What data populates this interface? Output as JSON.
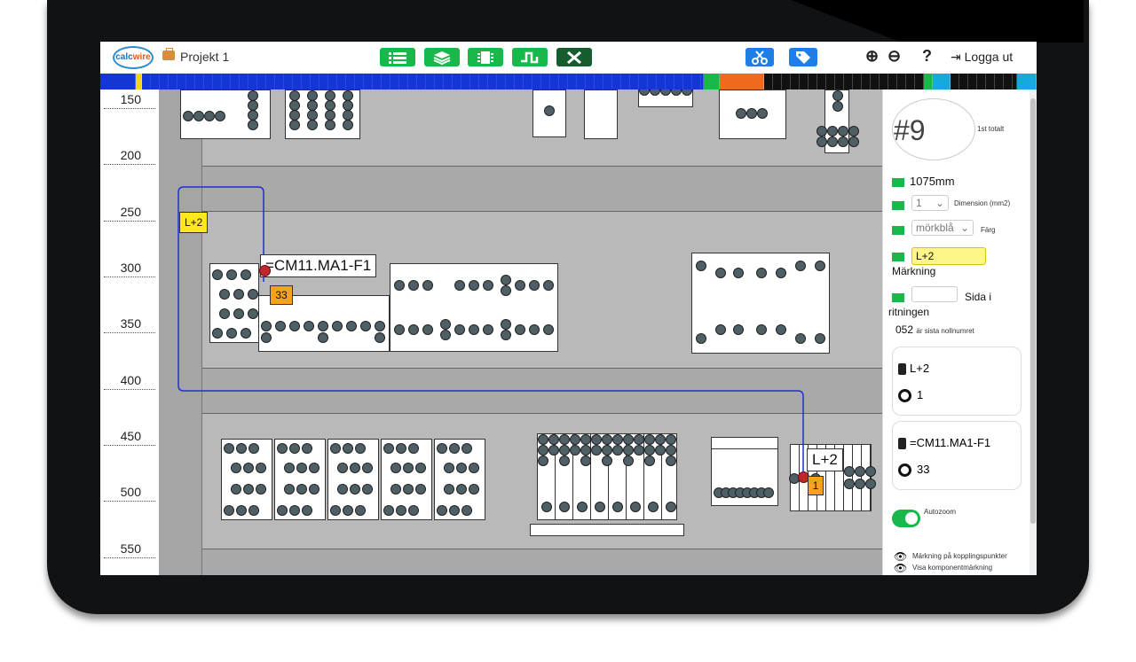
{
  "app": {
    "logo_calc": "calc",
    "logo_wire": "wire",
    "project": "Projekt 1",
    "logout": "Logga ut"
  },
  "toolbar": {
    "buttons": [
      "list-icon",
      "layers-icon",
      "component-icon",
      "signal-icon",
      "tools-icon"
    ],
    "right_buttons": [
      "cut-icon",
      "tag-icon"
    ],
    "zoom_in": "⊕",
    "zoom_out": "⊖",
    "help": "?"
  },
  "strip": {
    "marker_first": "1",
    "marker_selected": "L+2"
  },
  "ruler": {
    "ticks": [
      "150",
      "200",
      "250",
      "300",
      "350",
      "400",
      "450",
      "500",
      "550"
    ]
  },
  "canvas": {
    "start_label": "L+2",
    "start_component": "=CM11.MA1-F1",
    "start_point": "33",
    "end_label": "L+2",
    "end_point": "1"
  },
  "panel": {
    "wire_number": "#9",
    "wire_number_note": "1st totalt",
    "length": "1075mm",
    "dimension_value": "1",
    "dimension_label": "Dimension (mm2)",
    "color_value": "mörkblå",
    "color_label": "Färg",
    "marking_value": "L+2",
    "marking_label": "Märkning",
    "page_label": "Sida i ritningen",
    "last_number": "052",
    "last_number_note": "är sista nollnumret",
    "card1_label": "L+2",
    "card1_point": "1",
    "card2_label": "=CM11.MA1-F1",
    "card2_point": "33",
    "autozoom_label": "Autozoom",
    "opt1": "Märkning på kopplingspunkter",
    "opt2": "Visa komponentmärkning"
  },
  "colors": {
    "strip_blue": "#1536d6",
    "green": "#18b84b",
    "wire": "#1f2fd6",
    "label_yellow": "#ffe81a",
    "label_orange": "#f7a21b"
  }
}
